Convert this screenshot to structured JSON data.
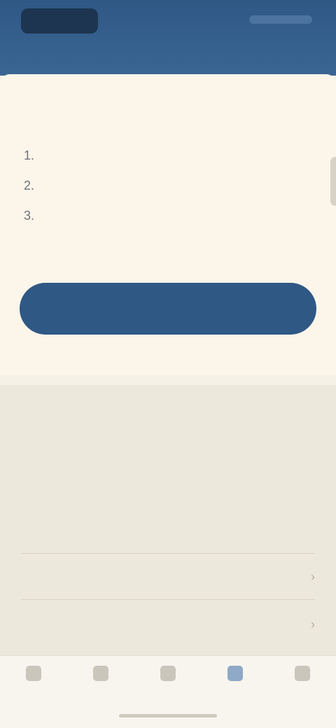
{
  "header": {
    "subtitle": ""
  },
  "card": {
    "title": "",
    "steps": [
      {
        "num": "1.",
        "text": ""
      },
      {
        "num": "2.",
        "text": ""
      },
      {
        "num": "3.",
        "text": ""
      }
    ],
    "primary_button": ""
  },
  "section": {
    "title": "",
    "body": "",
    "rows": [
      {
        "label": ""
      },
      {
        "label": ""
      }
    ]
  },
  "tabbar": {
    "tabs": [
      {
        "label": "",
        "icon": "home-icon"
      },
      {
        "label": "",
        "icon": "search-icon"
      },
      {
        "label": "",
        "icon": "list-icon"
      },
      {
        "label": "",
        "icon": "bookmark-icon",
        "active": true
      },
      {
        "label": "",
        "icon": "profile-icon"
      }
    ]
  },
  "colors": {
    "brand": "#2f5885",
    "background": "#f6f1e6",
    "section_bg": "#ede8dc"
  }
}
